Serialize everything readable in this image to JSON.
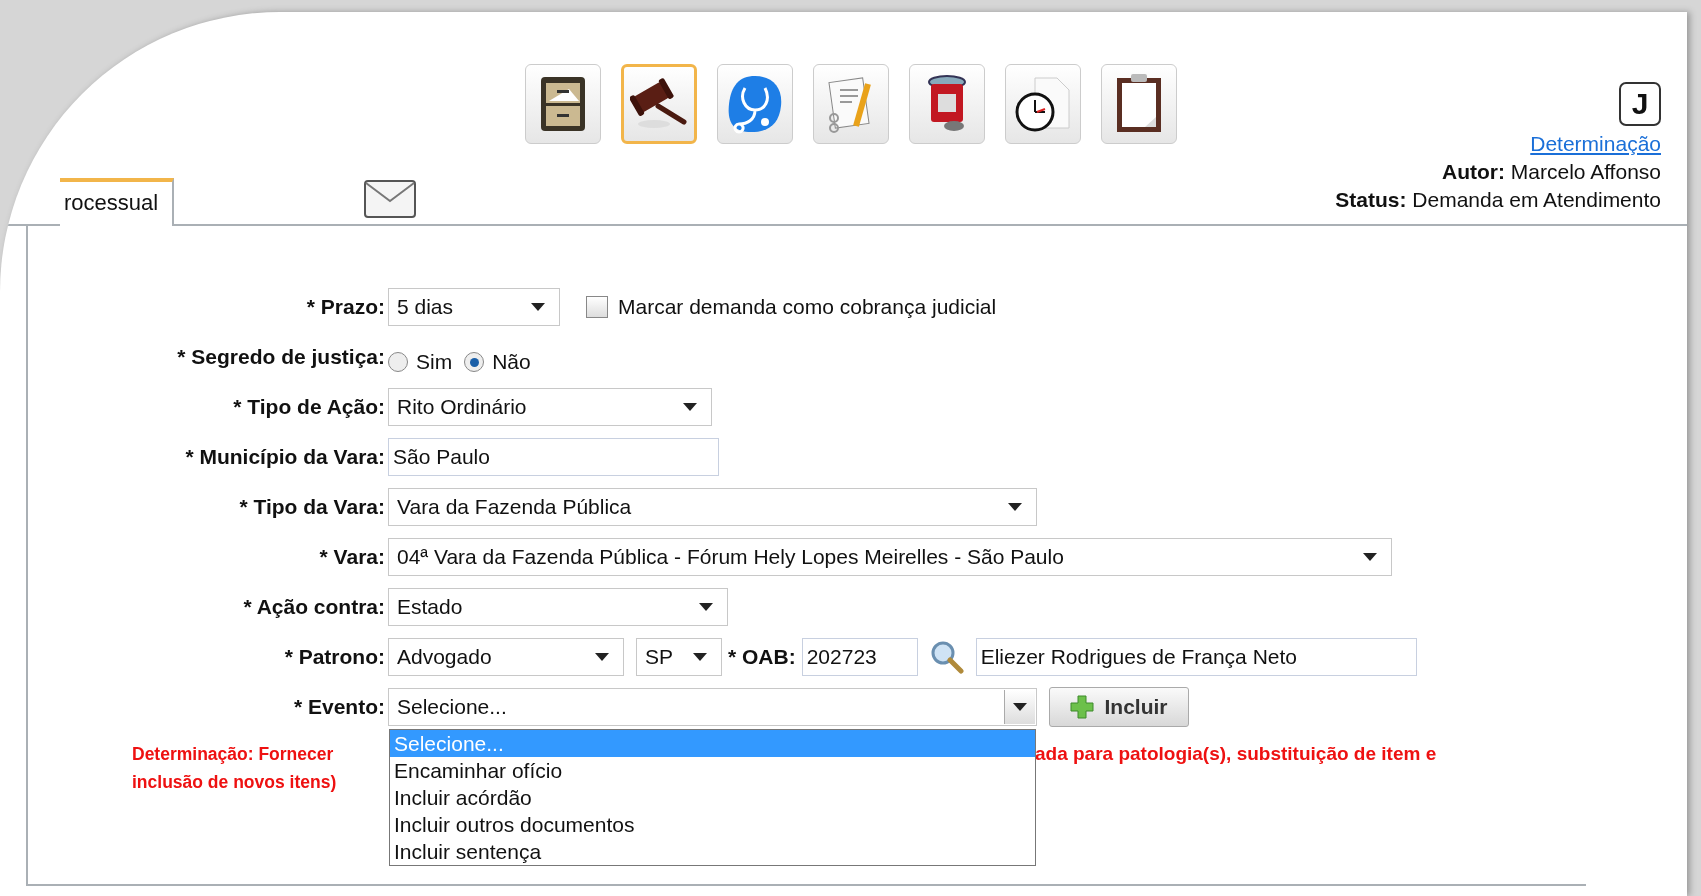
{
  "toolbar": {
    "icons": [
      {
        "kind": "file-cabinet",
        "selected": false
      },
      {
        "kind": "gavel",
        "selected": true
      },
      {
        "kind": "stethoscope",
        "selected": false
      },
      {
        "kind": "document-pencil",
        "selected": false
      },
      {
        "kind": "medicine-jar",
        "selected": false
      },
      {
        "kind": "clock-document",
        "selected": false
      },
      {
        "kind": "clipboard",
        "selected": false
      }
    ]
  },
  "badge": "J",
  "header": {
    "link": "Determinação",
    "author_label": "Autor:",
    "author": "Marcelo Affonso",
    "status_label": "Status:",
    "status": "Demanda em Atendimento"
  },
  "tab": {
    "label": "rocessual",
    "selected": true
  },
  "form": {
    "rows": [
      {
        "kind": "select",
        "label": "* Prazo:",
        "value": "5 dias",
        "checkbox": {
          "label": "Marcar demanda como cobrança judicial",
          "checked": false
        }
      },
      {
        "kind": "radio",
        "label": "* Segredo de justiça:",
        "options": [
          {
            "label": "Sim",
            "selected": false
          },
          {
            "label": "Não",
            "selected": true
          }
        ]
      },
      {
        "kind": "select",
        "label": "* Tipo de Ação:",
        "value": "Rito Ordinário"
      },
      {
        "kind": "text",
        "label": "* Município da Vara:",
        "value": "São Paulo"
      },
      {
        "kind": "select",
        "label": "* Tipo da Vara:",
        "value": "Vara da Fazenda Pública"
      },
      {
        "kind": "select",
        "label": "* Vara:",
        "value": "04ª Vara da Fazenda Pública - Fórum Hely Lopes Meirelles - São Paulo"
      },
      {
        "kind": "select",
        "label": "* Ação contra:",
        "value": "Estado"
      },
      {
        "kind": "patrono",
        "label": "* Patrono:",
        "value": "Advogado",
        "uf": "SP",
        "oab_label": "* OAB:",
        "oab": "202723",
        "name": "Eliezer Rodrigues de França Neto"
      },
      {
        "kind": "event",
        "label": "* Evento:",
        "value": "Selecione...",
        "open": true,
        "button": "Incluir",
        "options": [
          {
            "label": "Selecione...",
            "selected": true
          },
          {
            "label": "Encaminhar ofício",
            "selected": false
          },
          {
            "label": "Incluir acórdão",
            "selected": false
          },
          {
            "label": "Incluir outros documentos",
            "selected": false
          },
          {
            "label": "Incluir sentença",
            "selected": false
          }
        ]
      }
    ]
  },
  "note": {
    "left_lines": [
      "Determinação: Fornecer",
      "inclusão de novos itens)"
    ],
    "right": "ada para patologia(s), substituição de item e"
  }
}
